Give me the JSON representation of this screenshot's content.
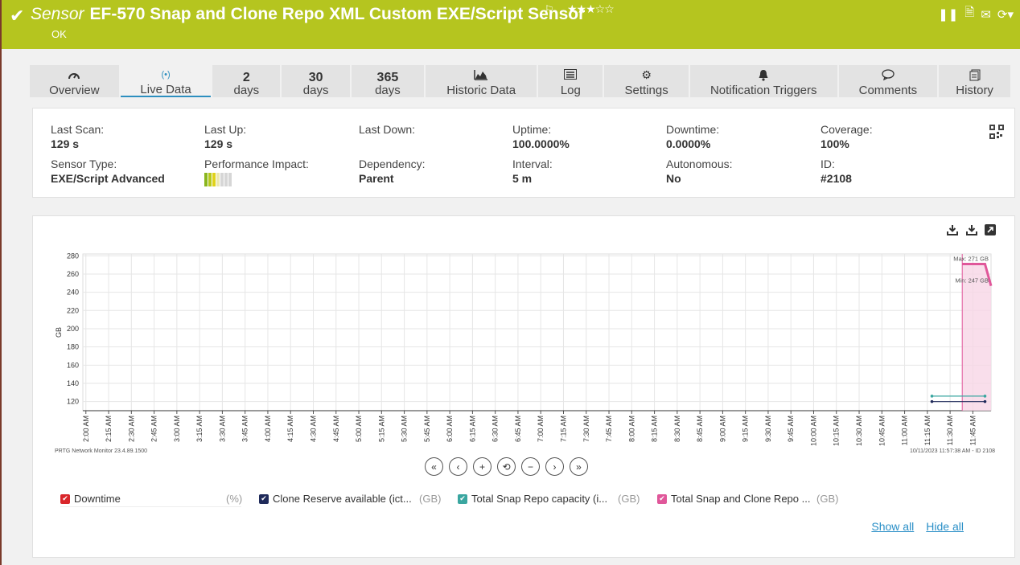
{
  "header": {
    "sensor_label": "Sensor",
    "sensor_name": "EF-570 Snap and Clone Repo XML Custom EXE/Script Sensor",
    "status": "OK",
    "stars": "★★★☆☆"
  },
  "tabs": [
    {
      "icon": "gauge-icon",
      "glyph": "◔",
      "label": "Overview"
    },
    {
      "icon": "broadcast-icon",
      "glyph": "(•)",
      "label": "Live Data"
    },
    {
      "number": "2",
      "label": "days"
    },
    {
      "number": "30",
      "label": "days"
    },
    {
      "number": "365",
      "label": "days"
    },
    {
      "icon": "area-chart-icon",
      "glyph": "▟",
      "label": "Historic Data"
    },
    {
      "icon": "log-icon",
      "glyph": "▤",
      "label": "Log"
    },
    {
      "icon": "gear-icon",
      "glyph": "⚙",
      "label": "Settings"
    },
    {
      "icon": "bell-icon",
      "glyph": "🔔",
      "label": "Notification Triggers"
    },
    {
      "icon": "comment-icon",
      "glyph": "◯",
      "label": "Comments"
    },
    {
      "icon": "history-icon",
      "glyph": "⎘",
      "label": "History"
    }
  ],
  "info": {
    "last_scan": {
      "label": "Last Scan:",
      "value": "129 s"
    },
    "last_up": {
      "label": "Last Up:",
      "value": "129 s"
    },
    "last_down": {
      "label": "Last Down:",
      "value": ""
    },
    "uptime": {
      "label": "Uptime:",
      "value": "100.0000%"
    },
    "downtime": {
      "label": "Downtime:",
      "value": "0.0000%"
    },
    "coverage": {
      "label": "Coverage:",
      "value": "100%"
    },
    "sensor_type": {
      "label": "Sensor Type:",
      "value": "EXE/Script Advanced"
    },
    "performance_impact": {
      "label": "Performance Impact:",
      "level": 3,
      "max": 7
    },
    "dependency": {
      "label": "Dependency:",
      "value": "Parent"
    },
    "interval": {
      "label": "Interval:",
      "value": "5 m"
    },
    "autonomous": {
      "label": "Autonomous:",
      "value": "No"
    },
    "id": {
      "label": "ID:",
      "value": "#2108"
    }
  },
  "chart_data": {
    "type": "line",
    "ylabel": "GB",
    "ylim": [
      110,
      282
    ],
    "yticks": [
      120,
      140,
      160,
      180,
      200,
      220,
      240,
      260,
      280
    ],
    "x_labels": [
      "2:00 AM",
      "2:15 AM",
      "2:30 AM",
      "2:45 AM",
      "3:00 AM",
      "3:15 AM",
      "3:30 AM",
      "3:45 AM",
      "4:00 AM",
      "4:15 AM",
      "4:30 AM",
      "4:45 AM",
      "5:00 AM",
      "5:15 AM",
      "5:30 AM",
      "5:45 AM",
      "6:00 AM",
      "6:15 AM",
      "6:30 AM",
      "6:45 AM",
      "7:00 AM",
      "7:15 AM",
      "7:30 AM",
      "7:45 AM",
      "8:00 AM",
      "8:15 AM",
      "8:30 AM",
      "8:45 AM",
      "9:00 AM",
      "9:15 AM",
      "9:30 AM",
      "9:45 AM",
      "10:00 AM",
      "10:15 AM",
      "10:30 AM",
      "10:45 AM",
      "11:00 AM",
      "11:15 AM",
      "11:30 AM",
      "11:45 AM"
    ],
    "x_start": "1:58 AM",
    "x_end": "11:57 AM",
    "series": [
      {
        "name": "Clone Reserve available (ict...",
        "unit": "GB",
        "color": "#1f2a5a",
        "points": [
          [
            "11:18 AM",
            120
          ],
          [
            "11:53 AM",
            120
          ]
        ]
      },
      {
        "name": "Total Snap Repo capacity (i...",
        "unit": "GB",
        "color": "#3aa6a0",
        "points": [
          [
            "11:18 AM",
            126
          ],
          [
            "11:53 AM",
            126
          ]
        ]
      },
      {
        "name": "Total Snap and Clone Repo ...",
        "unit": "GB",
        "color": "#e0579a",
        "points": [
          [
            "11:38 AM",
            271
          ],
          [
            "11:53 AM",
            271
          ],
          [
            "11:57 AM",
            247
          ]
        ]
      }
    ],
    "annotations": {
      "max": "Max: 271 GB",
      "min": "Min: 247 GB"
    },
    "footer_left": "PRTG Network Monitor 23.4.89.1500",
    "footer_right": "10/11/2023 11:57:38 AM - ID 2108"
  },
  "legend": [
    {
      "label": "Downtime",
      "unit": "(%)",
      "color": "#d9262b"
    },
    {
      "label": "Clone Reserve available (ict...",
      "unit": "(GB)",
      "color": "#1f2a5a"
    },
    {
      "label": "Total Snap Repo capacity (i...",
      "unit": "(GB)",
      "color": "#3aa6a0"
    },
    {
      "label": "Total Snap and Clone Repo ...",
      "unit": "(GB)",
      "color": "#e0579a"
    }
  ],
  "links": {
    "show_all": "Show all",
    "hide_all": "Hide all"
  },
  "colors": {
    "header": "#b5c51f",
    "accent": "#2d8fbf"
  }
}
